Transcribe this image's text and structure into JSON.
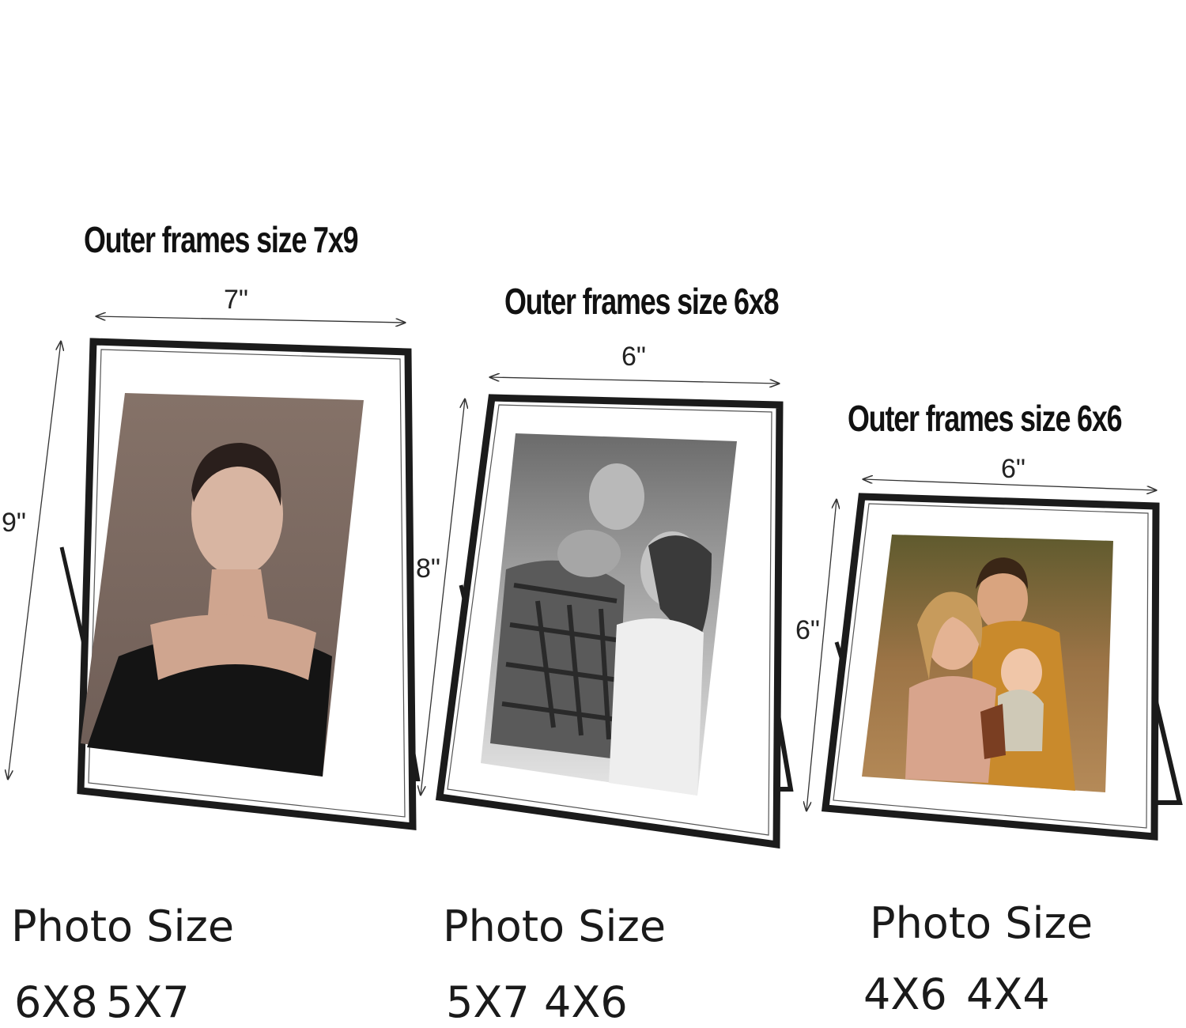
{
  "frames": [
    {
      "heading": "Outer frames size 7x9",
      "width_label": "7\"",
      "height_label": "9\"",
      "photo_label": "Photo Size",
      "photo_sizes": [
        "6X8",
        "5X7"
      ]
    },
    {
      "heading": "Outer frames size 6x8",
      "width_label": "6\"",
      "height_label": "8\"",
      "photo_label": "Photo Size",
      "photo_sizes": [
        "5X7",
        "4X6"
      ]
    },
    {
      "heading": "Outer frames size 6x6",
      "width_label": "6\"",
      "height_label": "6\"",
      "photo_label": "Photo Size",
      "photo_sizes": [
        "4X6",
        "4X4"
      ]
    }
  ],
  "colors": {
    "frame": "#1b1b1b",
    "mat": "#ffffff",
    "photo1_bg": "#7d6a62",
    "photo2_bg": "#8a8a8a",
    "photo3_bg": "#8a6a3a"
  }
}
